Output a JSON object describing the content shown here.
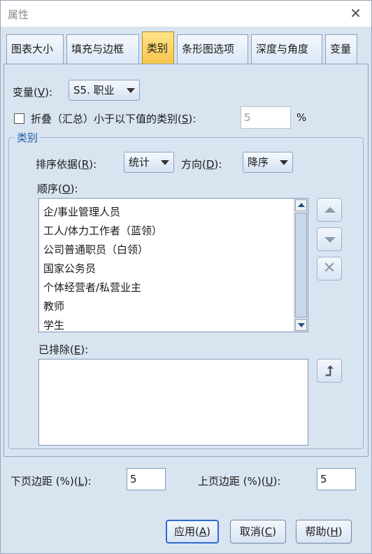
{
  "window": {
    "title": "属性",
    "close_glyph": "✕"
  },
  "tabs": [
    {
      "label": "图表大小",
      "active": false
    },
    {
      "label": "填充与边框",
      "active": false
    },
    {
      "label": "类别",
      "active": true
    },
    {
      "label": "条形图选项",
      "active": false
    },
    {
      "label": "深度与角度",
      "active": false
    },
    {
      "label": "变量",
      "active": false
    }
  ],
  "variable": {
    "label_pre": "变量(",
    "key": "V",
    "label_post": "):",
    "value": "S5. 职业"
  },
  "collapse": {
    "checked": false,
    "label_pre": "折叠（汇总）小于以下值的类别(",
    "key": "S",
    "label_post": "):",
    "value": "5",
    "unit": "%"
  },
  "categories_group": {
    "legend": "类别",
    "sort_by": {
      "label_pre": "排序依据(",
      "key": "R",
      "label_post": "):",
      "value": "统计"
    },
    "direction": {
      "label_pre": "方向(",
      "key": "D",
      "label_post": "):",
      "value": "降序"
    },
    "order": {
      "label_pre": "顺序(",
      "key": "O",
      "label_post": "):",
      "items": [
        "企/事业管理人员",
        "工人/体力工作者（蓝领）",
        "公司普通职员（白领）",
        "国家公务员",
        "个体经营者/私营业主",
        "教师",
        "学生"
      ]
    },
    "excluded": {
      "label_pre": "已排除(",
      "key": "E",
      "label_post": "):",
      "items": []
    }
  },
  "margins": {
    "lower": {
      "label_pre": "下页边距 (%)(",
      "key": "L",
      "label_post": "):",
      "value": "5"
    },
    "upper": {
      "label_pre": "上页边距 (%)(",
      "key": "U",
      "label_post": "):",
      "value": "5"
    }
  },
  "buttons": {
    "apply": {
      "pre": "应用(",
      "key": "A",
      "post": ")"
    },
    "cancel": {
      "pre": "取消(",
      "key": "C",
      "post": ")"
    },
    "help": {
      "pre": "帮助(",
      "key": "H",
      "post": ")"
    }
  },
  "colors": {
    "dialog_bg": "#d9e4f1",
    "active_tab": "#f7c64a",
    "accent_blue": "#1f5aa6"
  }
}
